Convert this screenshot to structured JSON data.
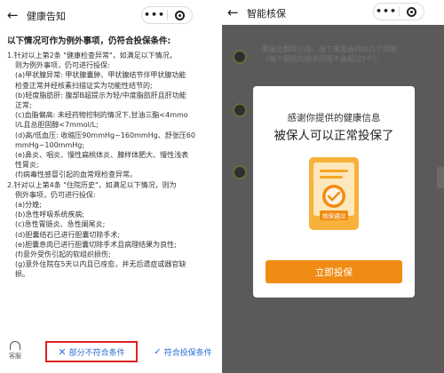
{
  "left": {
    "nav": {
      "back_icon": "←",
      "title": "健康告知",
      "dots": "•••"
    },
    "heading": "以下情况可作为例外事项，仍符合投保条件:",
    "paragraphs": [
      {
        "text": "1.针对以上第2条 \"健康检查异常\"，如满足以下情况，",
        "indent": false
      },
      {
        "text": "则为例外事项，仍可进行投保:",
        "indent": true
      },
      {
        "text": "(a)甲状腺异常: 甲状腺囊肿、甲状腺结节伴甲状腺功能",
        "indent": true
      },
      {
        "text": "检查正常并经核素扫描证实为功能性结节的;",
        "indent": true
      },
      {
        "text": "(b)轻度脂肪肝: 腹部B超提示为轻/中度脂肪肝且肝功能",
        "indent": true
      },
      {
        "text": "正常;",
        "indent": true
      },
      {
        "text": "(c)血脂偏高: 未经药物控制的情况下,甘油三酯<4mmo",
        "indent": true
      },
      {
        "text": "l/L且总胆固醇<7mmol/L;",
        "indent": true
      },
      {
        "text": "(d)高/低血压: 收缩压90mmHg~160mmHg、舒张压60",
        "indent": true
      },
      {
        "text": "mmHg~100mmHg;",
        "indent": true
      },
      {
        "text": "(e)鼻炎、咽炎、慢性扁桃体炎、腺样体肥大、慢性浅表",
        "indent": true
      },
      {
        "text": "性胃炎;",
        "indent": true
      },
      {
        "text": "(f)病毒性感冒引起的血常规检查异常。",
        "indent": true
      },
      {
        "text": "2.针对以上第4条 \"住院历史\"，如满足以下情况，则为",
        "indent": false
      },
      {
        "text": "例外事项，仍可进行投保:",
        "indent": true
      },
      {
        "text": "(a)分娩;",
        "indent": true
      },
      {
        "text": "(b)急性呼吸系统疾病;",
        "indent": true
      },
      {
        "text": "(c)急性胃肠炎、急性阑尾炎;",
        "indent": true
      },
      {
        "text": "(d)胆囊结石已进行胆囊切除手术;",
        "indent": true
      },
      {
        "text": "(e)胆囊息肉已进行胆囊切除手术且病理结果为良性;",
        "indent": true
      },
      {
        "text": "(f)意外受伤引起的软组织损伤;",
        "indent": true
      },
      {
        "text": "(g)意外住院在5天以内且已痊愈，并无后遗症或器官缺",
        "indent": true
      },
      {
        "text": "损。",
        "indent": true
      }
    ],
    "bottom": {
      "cs_label": "客服",
      "partial_icon": "✕",
      "partial_label": "部分不符合条件",
      "meets_icon": "✓",
      "meets_label": "符合投保条件"
    }
  },
  "right": {
    "nav": {
      "back_icon": "←",
      "title": "智能核保",
      "dots": "•••"
    },
    "chat_text": "我是企鹅保小保，接下来我会问你几个问题（每个保险的相关问题不会超过5个）。",
    "modal": {
      "line1": "感谢你提供的健康信息",
      "line2": "被保人可以正常投保了",
      "stamp_text": "核保通过",
      "button": "立即投保"
    }
  },
  "colors": {
    "accent_blue": "#2c6fd6",
    "highlight_red": "#e02020",
    "orange": "#f08c15",
    "overlay": "#5a5a5a"
  }
}
